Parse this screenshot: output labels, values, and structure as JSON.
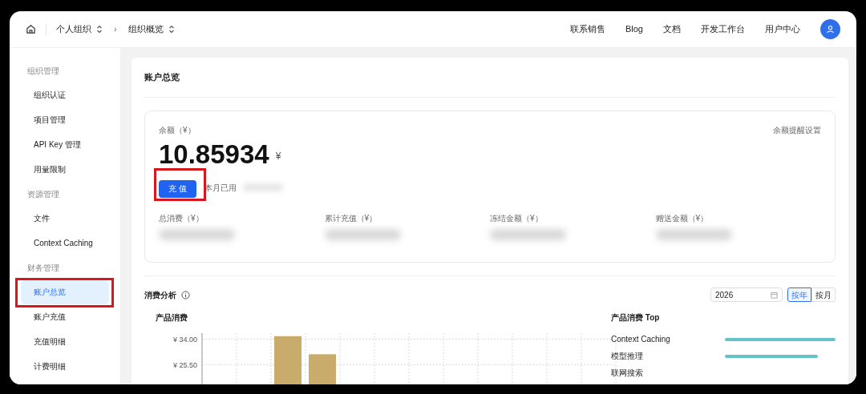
{
  "header": {
    "breadcrumbs": [
      {
        "label": "个人组织"
      },
      {
        "label": "组织概览"
      }
    ],
    "separator": "›",
    "nav": [
      "联系销售",
      "Blog",
      "文档",
      "开发工作台",
      "用户中心"
    ]
  },
  "sidebar": {
    "groups": [
      {
        "title": "组织管理",
        "items": [
          {
            "label": "组织认证",
            "selected": false
          },
          {
            "label": "项目管理",
            "selected": false
          },
          {
            "label": "API Key 管理",
            "selected": false
          },
          {
            "label": "用量限制",
            "selected": false
          }
        ]
      },
      {
        "title": "资源管理",
        "items": [
          {
            "label": "文件",
            "selected": false
          },
          {
            "label": "Context Caching",
            "selected": false
          }
        ]
      },
      {
        "title": "财务管理",
        "items": [
          {
            "label": "账户总览",
            "selected": true
          },
          {
            "label": "账户充值",
            "selected": false
          },
          {
            "label": "充值明细",
            "selected": false
          },
          {
            "label": "计费明细",
            "selected": false
          }
        ]
      }
    ]
  },
  "page_title": "账户总览",
  "balance": {
    "label": "余额（¥）",
    "amount": "10.85934",
    "currency": "¥",
    "alert_link": "余额提醒设置",
    "recharge_button": "充 值",
    "month_used_label": "本月已用"
  },
  "stats": [
    {
      "label": "总消费（¥）"
    },
    {
      "label": "累计充值（¥）"
    },
    {
      "label": "冻结金额（¥）"
    },
    {
      "label": "赠送金额（¥）"
    }
  ],
  "analysis": {
    "title": "消费分析",
    "year": "2026",
    "modes": [
      {
        "label": "按年",
        "selected": true
      },
      {
        "label": "按月",
        "selected": false
      }
    ],
    "chart": {
      "title": "产品消费",
      "chart_data": {
        "type": "bar",
        "ylim": [
          0,
          36
        ],
        "yticks": [
          {
            "value": 34,
            "label": "¥ 34.00"
          },
          {
            "value": 25.5,
            "label": "¥ 25.50"
          }
        ],
        "series": [
          {
            "color": "#c9ab6b",
            "values": [
              null,
              null,
              35,
              29,
              null,
              null,
              null,
              null,
              null,
              null,
              null,
              null
            ]
          }
        ]
      }
    },
    "top": {
      "title": "产品消费 Top",
      "items": [
        {
          "label": "Context Caching",
          "level": 1
        },
        {
          "label": "模型推理",
          "level": 0.84
        },
        {
          "label": "联网搜索"
        }
      ]
    }
  }
}
